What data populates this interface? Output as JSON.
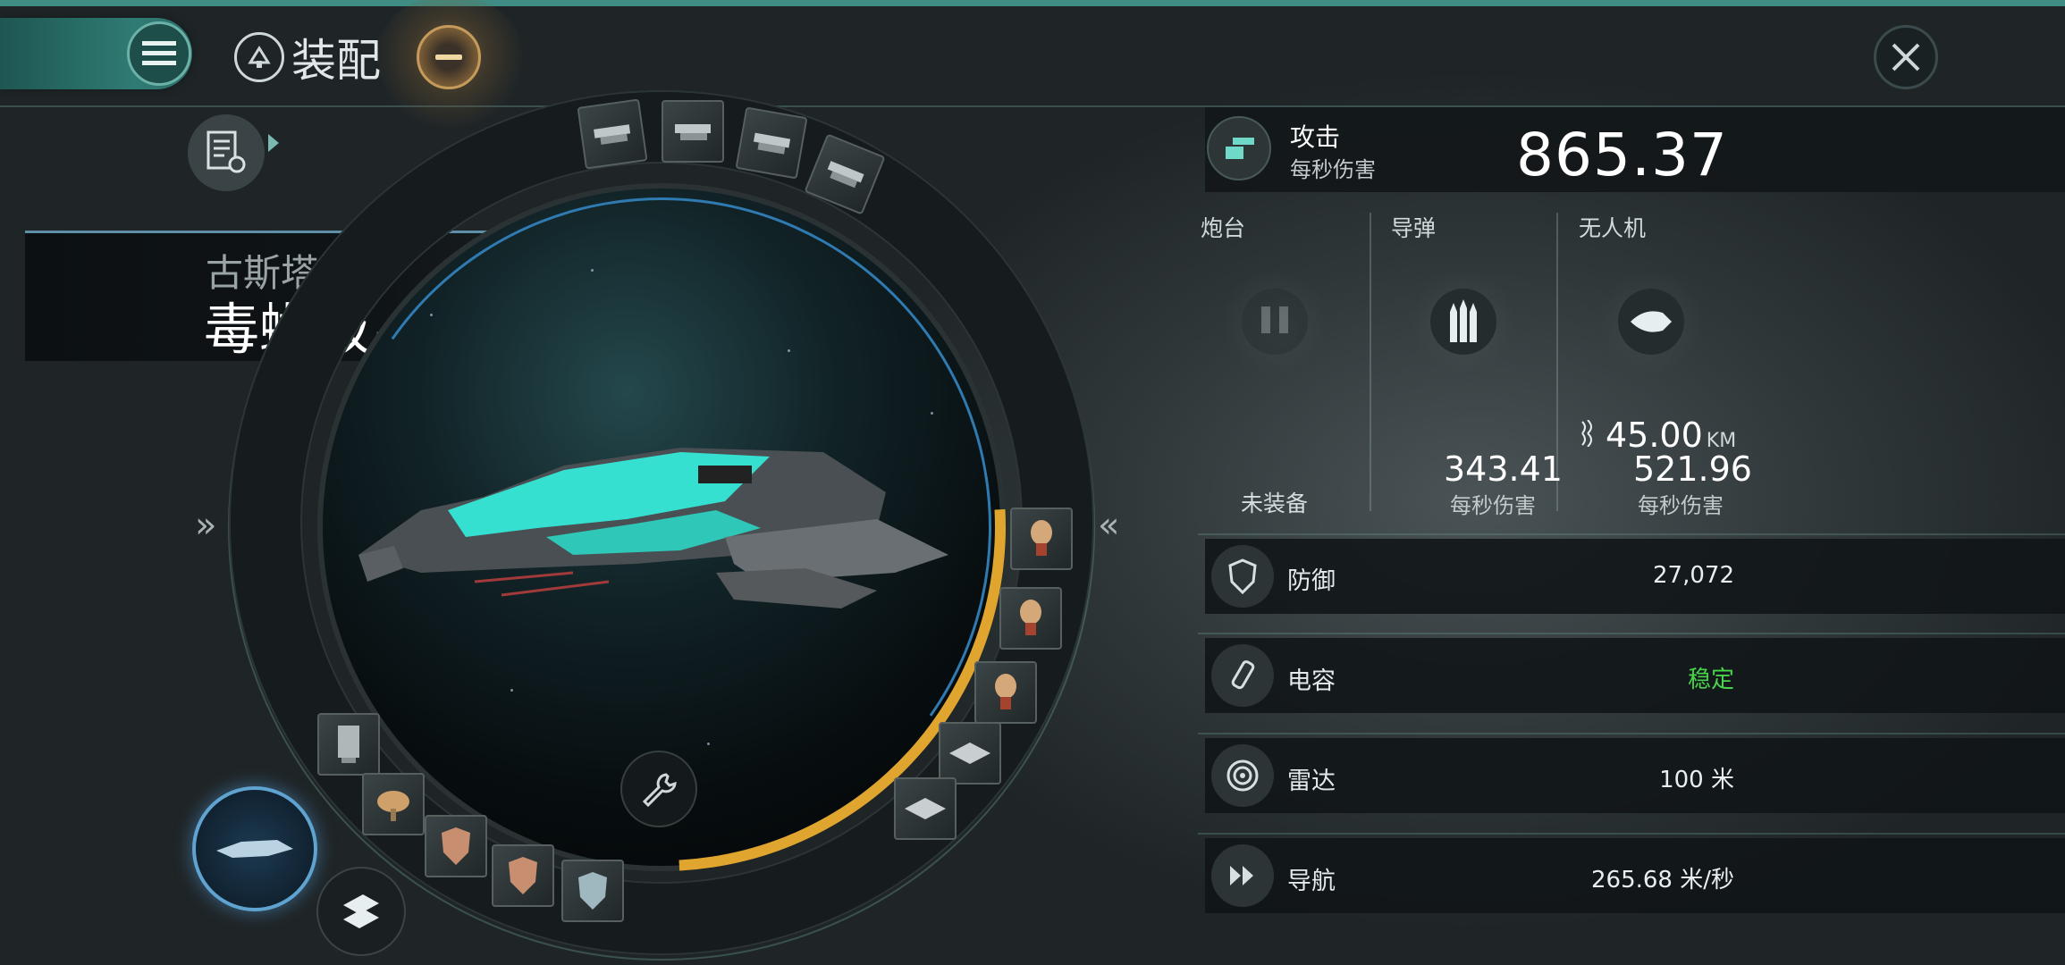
{
  "header": {
    "title": "装配",
    "menu_icon": "hamburger-icon",
    "close_icon": "close-icon"
  },
  "ship": {
    "class_name": "古斯塔斯",
    "ship_name": "毒蜥级",
    "name_chevron": "»"
  },
  "side": {
    "left_chevron": "»",
    "right_chevron": "«"
  },
  "attack": {
    "label": "攻击",
    "sub_label": "每秒伤害",
    "value": "865.37"
  },
  "weapons": {
    "turret": {
      "label": "炮台",
      "status": "未装备"
    },
    "missile": {
      "label": "导弹",
      "dps": "343.41",
      "dps_label": "每秒伤害"
    },
    "drone": {
      "label": "无人机",
      "range": "45.00",
      "range_unit": "KM",
      "dps": "521.96",
      "dps_label": "每秒伤害"
    }
  },
  "stats": [
    {
      "label": "防御",
      "value": "27,072",
      "icon": "shield-icon"
    },
    {
      "label": "电容",
      "value": "稳定",
      "icon": "capacitor-icon",
      "color": "#49d44b"
    },
    {
      "label": "雷达",
      "value": "100 米",
      "icon": "radar-icon"
    },
    {
      "label": "导航",
      "value": "265.68 米/秒",
      "icon": "navigation-icon"
    }
  ],
  "colors": {
    "accent": "#3f8c84",
    "capacitor_arc": "#e0a52e",
    "stable_green": "#49d44b",
    "ship_primary": "#36e0d0"
  }
}
